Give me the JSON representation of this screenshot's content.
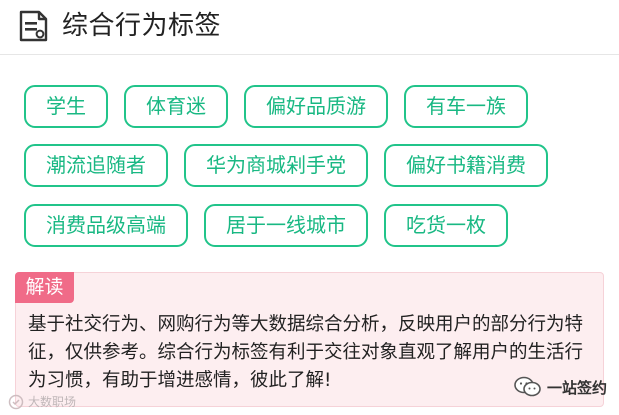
{
  "header": {
    "title": "综合行为标签",
    "icon": "document-list-icon"
  },
  "tags": {
    "row1": [
      "学生",
      "体育迷",
      "偏好品质游",
      "有车一族"
    ],
    "row2": [
      "潮流追随者",
      "华为商城剁手党",
      "偏好书籍消费"
    ],
    "row3": [
      "消费品级高端",
      "居于一线城市",
      "吃货一枚"
    ]
  },
  "interpretation": {
    "badge": "解读",
    "text": "基于社交行为、网购行为等大数据综合分析，反映用户的部分行为特征，仅供参考。综合行为标签有利于交往对象直观了解用户的生活行为习惯，有助于增进感情，彼此了解!"
  },
  "watermarks": {
    "left": "大数职场",
    "right": "一站签约"
  },
  "colors": {
    "tag_border": "#21c48a",
    "tag_text": "#19b883",
    "badge_bg": "#f06b88",
    "panel_bg": "#fdeef0"
  }
}
